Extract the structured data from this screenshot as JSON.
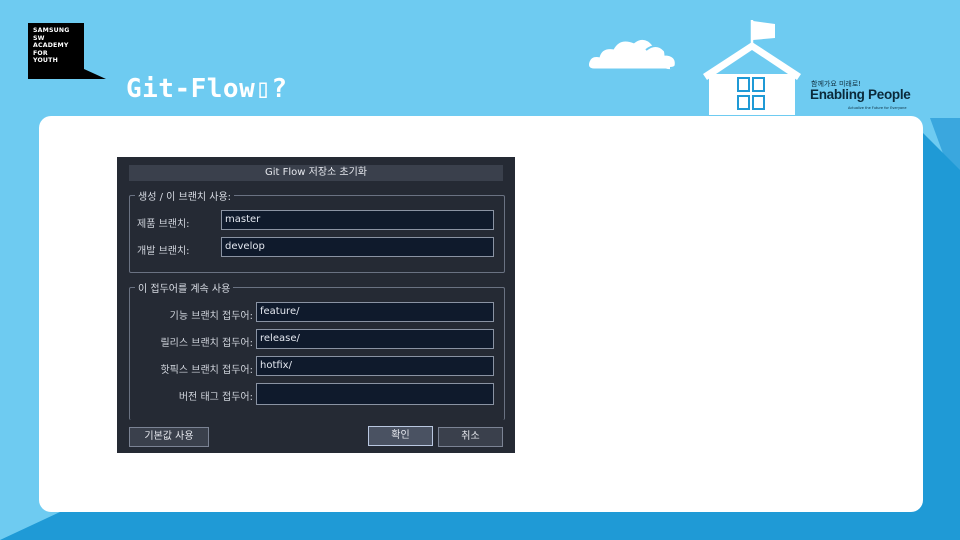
{
  "slide": {
    "title": "Git-Flow▯?",
    "logo_lines": [
      "SAMSUNG",
      "SW",
      "ACADEMY",
      "FOR",
      "YOUTH"
    ],
    "slogan_small": "함께가요 미래로!",
    "slogan_big": "Enabling People",
    "slogan_tiny": "Actualize the Future for Everyone",
    "colors": {
      "background": "#6ecbf1",
      "accent_dark": "#1f9ad6",
      "card": "#ffffff"
    }
  },
  "dialog": {
    "title": "Git Flow 저장소 초기화",
    "group1_label": "생성 / 이 브랜치 사용:",
    "prod_label": "제품 브랜치:",
    "prod_value": "master",
    "dev_label": "개발 브랜치:",
    "dev_value": "develop",
    "group2_label": "이 접두어를 계속 사용",
    "feature_label": "기능 브랜치 접두어:",
    "feature_value": "feature/",
    "release_label": "릴리스 브랜치 접두어:",
    "release_value": "release/",
    "hotfix_label": "핫픽스 브랜치 접두어:",
    "hotfix_value": "hotfix/",
    "version_label": "버전 태그 접두어:",
    "version_value": "",
    "defaults_button": "기본값 사용",
    "ok_button": "확인",
    "cancel_button": "취소"
  }
}
